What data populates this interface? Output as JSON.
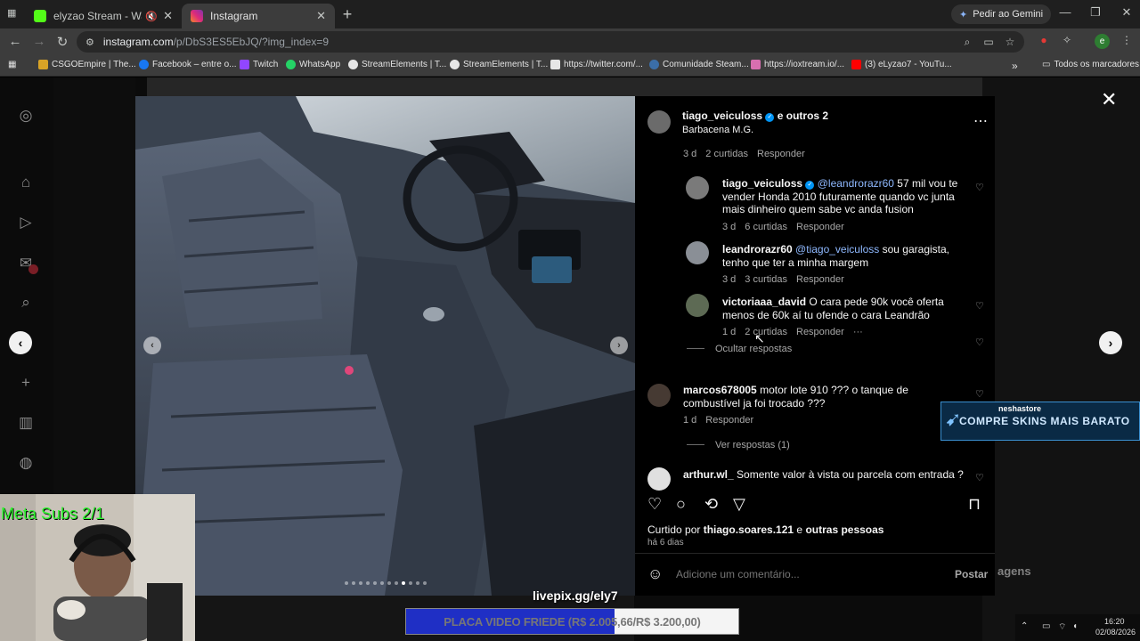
{
  "browser": {
    "tabs": [
      {
        "title": "elyzao Stream - Watch Live",
        "favicon_color": "#53fc18",
        "audio_icon": "muted-speaker-icon"
      },
      {
        "title": "Instagram",
        "favicon_color": "#e1306c"
      }
    ],
    "gemini_label": "Pedir ao Gemini",
    "url_host": "instagram.com",
    "url_path": "/p/DbS3ES5EbJQ/?img_index=9",
    "profile_initial": "e",
    "bookmarks": [
      {
        "label": "CSGOEmpire | The...",
        "color": "#d9a326"
      },
      {
        "label": "Facebook – entre o...",
        "color": "#1877f2"
      },
      {
        "label": "Twitch",
        "color": "#9146ff"
      },
      {
        "label": "WhatsApp",
        "color": "#25d366"
      },
      {
        "label": "StreamElements | T...",
        "color": "#e6e6e6"
      },
      {
        "label": "StreamElements | T...",
        "color": "#e6e6e6"
      },
      {
        "label": "https://twitter.com/...",
        "color": "#e6e6e6"
      },
      {
        "label": "Comunidade Steam...",
        "color": "#3b6ea8"
      },
      {
        "label": "https://ioxtream.io/...",
        "color": "#d86fb0"
      },
      {
        "label": "(3) eLyzao7 - YouTu...",
        "color": "#ff0000"
      }
    ],
    "all_bookmarks_label": "Todos os marcadores"
  },
  "post": {
    "header": {
      "username": "tiago_veiculoss",
      "coauthors": "e outros 2",
      "location": "Barbacena M.G."
    },
    "top_meta": {
      "time": "3 d",
      "likes": "2 curtidas",
      "reply": "Responder"
    },
    "replies": [
      {
        "username": "tiago_veiculoss",
        "verified": true,
        "mention": "@leandrorazr60",
        "text": " 57 mil vou te vender Honda 2010 futuramente quando vc junta mais dinheiro quem sabe vc anda fusion",
        "time": "3 d",
        "likes": "6 curtidas",
        "reply": "Responder"
      },
      {
        "username": "leandrorazr60",
        "verified": false,
        "mention": "@tiago_veiculoss",
        "text": " sou garagista, tenho que ter a minha margem",
        "time": "3 d",
        "likes": "3 curtidas",
        "reply": "Responder"
      },
      {
        "username": "victoriaaa_david",
        "verified": false,
        "mention": "",
        "text": " O cara pede 90k você oferta menos de 60k aí tu ofende o cara Leandrão",
        "time": "1 d",
        "likes": "2 curtidas",
        "reply": "Responder",
        "more": "···"
      }
    ],
    "hide_replies": "Ocultar respostas",
    "comments": [
      {
        "username": "marcos678005",
        "text": " motor lote 910 ??? o tanque de combustível ja foi trocado ???",
        "time": "1 d",
        "reply": "Responder",
        "view_replies": "Ver respostas (1)"
      },
      {
        "username": "arthur.wl_",
        "text": " Somente valor à vista ou parcela com entrada ?"
      }
    ],
    "liked_by_prefix": "Curtido por ",
    "liked_by_user": "thiago.soares.121",
    "liked_by_mid": " e ",
    "liked_by_others": "outras pessoas",
    "posted_ago": "há 6 dias",
    "comment_placeholder": "Adicione um comentário...",
    "post_button": "Postar",
    "carousel": {
      "count": 12,
      "active_index": 9
    }
  },
  "overlays": {
    "webcam_label": "Meta Subs 2/1",
    "store_name": "neshastore",
    "store_promo": "COMPRE SKINS MAIS BARATO",
    "livepix": "livepix.gg/ely7",
    "goal_text": "PLACA VIDEO FRIEDE (R$ 2.005,66/R$ 3.200,00)",
    "goal_progress": 0.627,
    "watermark": "agens"
  },
  "taskbar": {
    "time": "16:20",
    "date": "02/08/2026"
  }
}
